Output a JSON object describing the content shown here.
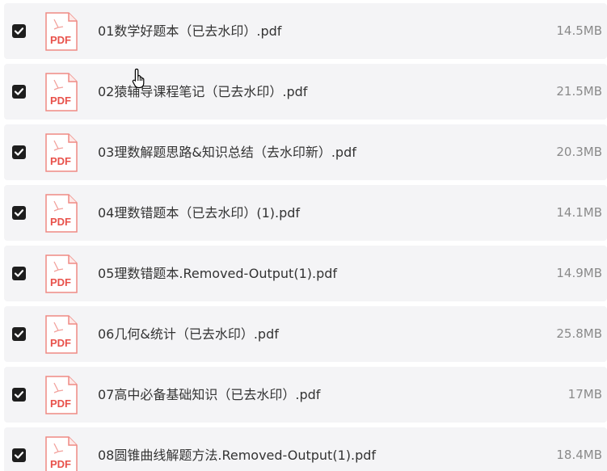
{
  "files": [
    {
      "name": "01数学好题本（已去水印）.pdf",
      "size": "14.5MB",
      "checked": true,
      "icon": "pdf-file-icon",
      "icon_text": "PDF"
    },
    {
      "name": "02猿辅导课程笔记（已去水印）.pdf",
      "size": "21.5MB",
      "checked": true,
      "icon": "pdf-file-icon",
      "icon_text": "PDF"
    },
    {
      "name": "03理数解题思路&知识总结（去水印新）.pdf",
      "size": "20.3MB",
      "checked": true,
      "icon": "pdf-file-icon",
      "icon_text": "PDF"
    },
    {
      "name": "04理数错题本（已去水印）(1).pdf",
      "size": "14.1MB",
      "checked": true,
      "icon": "pdf-file-icon",
      "icon_text": "PDF"
    },
    {
      "name": "05理数错题本.Removed-Output(1).pdf",
      "size": "14.9MB",
      "checked": true,
      "icon": "pdf-file-icon",
      "icon_text": "PDF"
    },
    {
      "name": "06几何&统计（已去水印）.pdf",
      "size": "25.8MB",
      "checked": true,
      "icon": "pdf-file-icon",
      "icon_text": "PDF"
    },
    {
      "name": "07高中必备基础知识（已去水印）.pdf",
      "size": "17MB",
      "checked": true,
      "icon": "pdf-file-icon",
      "icon_text": "PDF"
    },
    {
      "name": "08圆锥曲线解题方法.Removed-Output(1).pdf",
      "size": "18.4MB",
      "checked": true,
      "icon": "pdf-file-icon",
      "icon_text": "PDF"
    }
  ],
  "colors": {
    "row_background": "#f4f4f6",
    "checkbox": "#1e1e1e",
    "pdf_red": "#e8524b",
    "text": "#333333",
    "size_text": "#8a8a8a"
  },
  "cursor_icon": "hand-pointer-icon"
}
